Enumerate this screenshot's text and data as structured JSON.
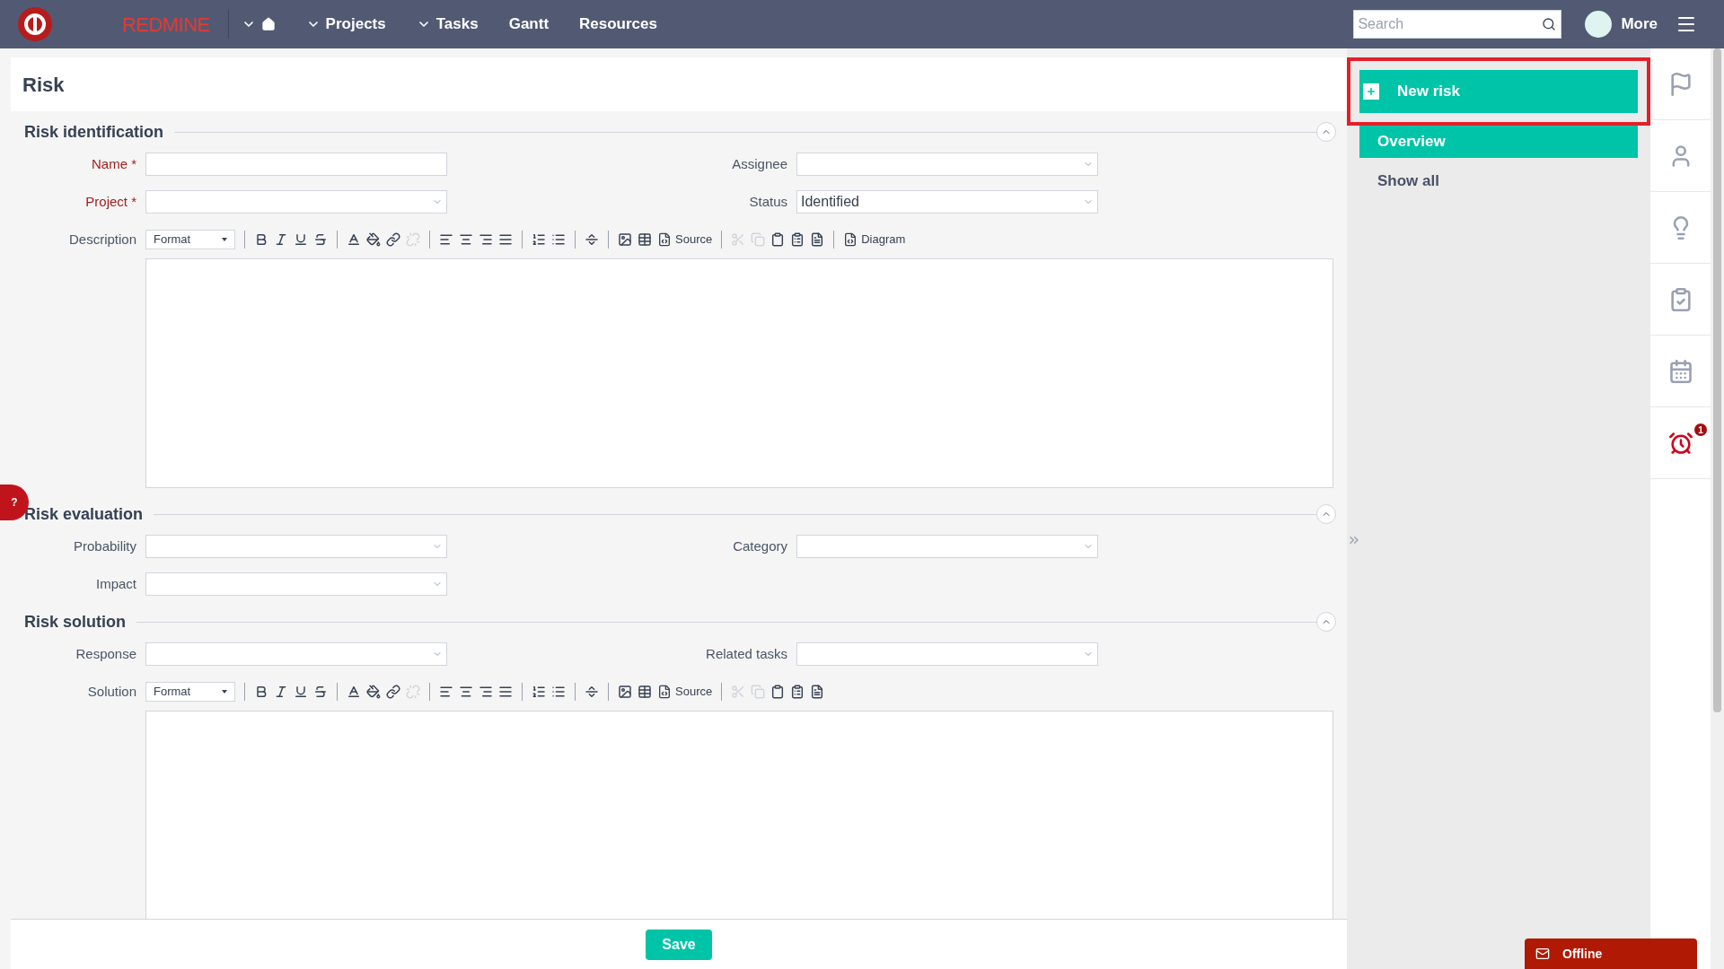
{
  "topbar": {
    "logo_text": "REDMINE",
    "nav": [
      {
        "kind": "home",
        "dropdown": true
      },
      {
        "kind": "text",
        "label": "Projects",
        "dropdown": true
      },
      {
        "kind": "text",
        "label": "Tasks",
        "dropdown": true
      },
      {
        "kind": "text",
        "label": "Gantt",
        "dropdown": false
      },
      {
        "kind": "text",
        "label": "Resources",
        "dropdown": false
      }
    ],
    "search": {
      "placeholder": "Search"
    },
    "more": "More"
  },
  "page": {
    "title": "Risk"
  },
  "sections": [
    {
      "title": "Risk identification",
      "expanded": true,
      "rows": [
        [
          {
            "label": "Name",
            "required": true,
            "kind": "text"
          },
          {
            "label": "Assignee",
            "required": false,
            "kind": "select"
          }
        ],
        [
          {
            "label": "Project",
            "required": true,
            "kind": "select"
          },
          {
            "label": "Status",
            "required": false,
            "kind": "select",
            "value": "Identified"
          }
        ]
      ],
      "editor": {
        "label": "Description",
        "format": "Format",
        "source": "Source",
        "diagram": "Diagram"
      }
    },
    {
      "title": "Risk evaluation",
      "expanded": true,
      "rows": [
        [
          {
            "label": "Probability",
            "required": false,
            "kind": "select"
          },
          {
            "label": "Category",
            "required": false,
            "kind": "select"
          }
        ],
        [
          {
            "label": "Impact",
            "required": false,
            "kind": "select"
          }
        ]
      ]
    },
    {
      "title": "Risk solution",
      "expanded": true,
      "rows": [
        [
          {
            "label": "Response",
            "required": false,
            "kind": "select"
          },
          {
            "label": "Related tasks",
            "required": false,
            "kind": "select"
          }
        ]
      ],
      "editor": {
        "label": "Solution",
        "format": "Format",
        "source": "Source"
      }
    }
  ],
  "required_mark": "*",
  "save": "Save",
  "sidebar": {
    "action": {
      "label": "New risk",
      "highlighted": true
    },
    "items": [
      {
        "label": "Overview",
        "selected": true
      },
      {
        "label": "Show all",
        "selected": false
      }
    ]
  },
  "rail": [
    {
      "kind": "flag"
    },
    {
      "kind": "user"
    },
    {
      "kind": "bulb"
    },
    {
      "kind": "tasks"
    },
    {
      "kind": "calendar"
    },
    {
      "kind": "alarm",
      "badge": "1"
    }
  ],
  "help_tab": "?",
  "chat": {
    "label": "Offline"
  }
}
